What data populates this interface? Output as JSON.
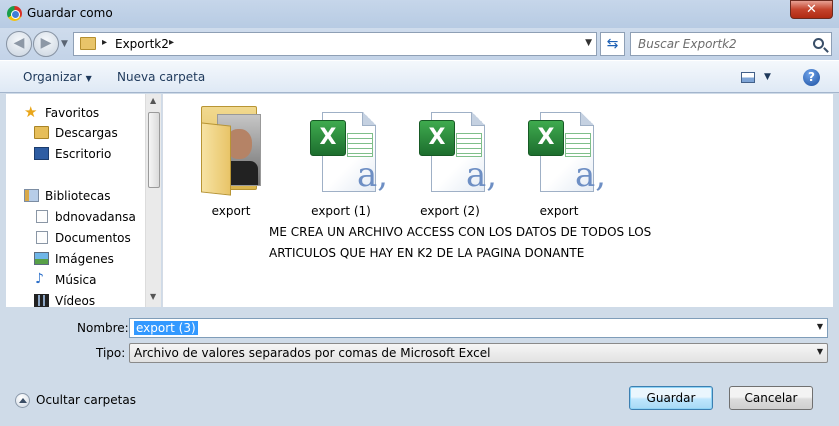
{
  "window": {
    "title": "Guardar como",
    "close_label": "✕"
  },
  "address": {
    "crumb": "Exportk2",
    "separator": "▸"
  },
  "search": {
    "placeholder": "Buscar Exportk2"
  },
  "toolbar": {
    "organize_label": "Organizar",
    "new_folder_label": "Nueva carpeta"
  },
  "nav": {
    "items": [
      {
        "label": "Favoritos",
        "icon": "star-icon"
      },
      {
        "label": "Descargas",
        "icon": "downloads-folder-icon"
      },
      {
        "label": "Escritorio",
        "icon": "desktop-icon"
      },
      {
        "label": "Bibliotecas",
        "icon": "libraries-icon"
      },
      {
        "label": "bdnovadansa",
        "icon": "document-icon"
      },
      {
        "label": "Documentos",
        "icon": "documents-icon"
      },
      {
        "label": "Imágenes",
        "icon": "pictures-icon"
      },
      {
        "label": "Música",
        "icon": "music-icon"
      },
      {
        "label": "Vídeos",
        "icon": "videos-icon"
      }
    ]
  },
  "files": [
    {
      "label": "export",
      "kind": "folder"
    },
    {
      "label": "export (1)",
      "kind": "excel-csv"
    },
    {
      "label": "export (2)",
      "kind": "excel-csv"
    },
    {
      "label": "export",
      "kind": "excel-csv"
    }
  ],
  "note": {
    "line1": "ME CREA UN ARCHIVO ACCESS CON LOS DATOS DE TODOS LOS",
    "line2": "ARTICULOS QUE HAY EN K2 DE LA PAGINA DONANTE"
  },
  "form": {
    "name_label": "Nombre:",
    "name_value": "export (3)",
    "type_label": "Tipo:",
    "type_value": "Archivo de valores separados por comas de Microsoft Excel"
  },
  "footer": {
    "hide_folders_label": "Ocultar carpetas",
    "save_label": "Guardar",
    "cancel_label": "Cancelar"
  }
}
